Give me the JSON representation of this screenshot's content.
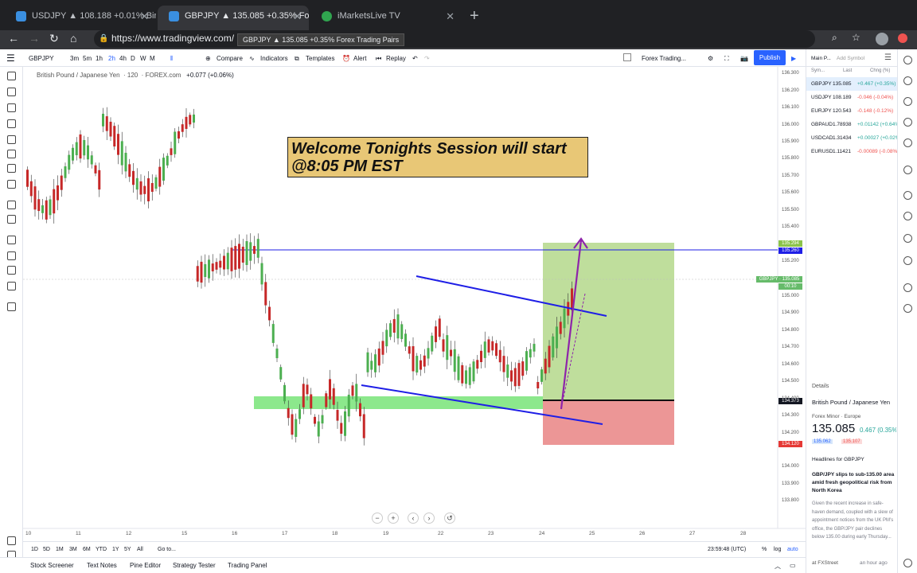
{
  "browser": {
    "tabs": [
      {
        "title": "USDJPY ▲ 108.188 +0.01% Bin"
      },
      {
        "title": "GBPJPY ▲ 135.085 +0.35% Fo"
      },
      {
        "title": "iMarketsLive TV"
      }
    ],
    "url": "https://www.tradingview.com/",
    "tooltip": "GBPJPY ▲ 135.085 +0.35% Forex Trading Pairs"
  },
  "toolbar": {
    "symbol": "GBPJPY",
    "intervals": [
      "3m",
      "5m",
      "1h",
      "2h",
      "4h",
      "D",
      "W",
      "M"
    ],
    "compare": "Compare",
    "indicators": "Indicators",
    "templates": "Templates",
    "alert": "Alert",
    "replay": "Replay",
    "layout": "Forex Trading...",
    "publish": "Publish"
  },
  "chart": {
    "symbol_title": "British Pound / Japanese Yen",
    "interval": "120",
    "exchange": "FOREX.com",
    "change": "+0.077 (+0.06%)",
    "banner_line1": "Welcome Tonights Session will start",
    "banner_line2": "@8:05 PM EST",
    "price_labels": {
      "p1": "135.294",
      "p2": "135.260",
      "p3": "GBPJPY · 135.085",
      "p3b": "00:10",
      "p4": "134.373",
      "p5": "134.120"
    },
    "time_ticks": [
      "10",
      "11",
      "12",
      "15",
      "16",
      "17",
      "18",
      "19",
      "22",
      "23",
      "24",
      "25",
      "26",
      "27",
      "28"
    ],
    "price_ticks": [
      "136.300",
      "136.200",
      "136.100",
      "136.000",
      "135.900",
      "135.800",
      "135.700",
      "135.600",
      "135.500",
      "135.400",
      "135.200",
      "135.000",
      "134.900",
      "134.800",
      "134.700",
      "134.600",
      "134.500",
      "134.400",
      "134.300",
      "134.200",
      "134.000",
      "133.900",
      "133.800"
    ]
  },
  "bottom": {
    "ranges": [
      "1D",
      "5D",
      "1M",
      "3M",
      "6M",
      "YTD",
      "1Y",
      "5Y",
      "All"
    ],
    "goto": "Go to...",
    "clock": "23:59:48 (UTC)",
    "pct": "%",
    "log": "log",
    "auto": "auto"
  },
  "panels": [
    "Stock Screener",
    "Text Notes",
    "Pine Editor",
    "Strategy Tester",
    "Trading Panel"
  ],
  "watchlist": {
    "title": "Main P...",
    "add": "Add Symbol",
    "cols": [
      "Sym...",
      "Last",
      "Chng (%)"
    ],
    "rows": [
      {
        "sym": "GBPJPY",
        "last": "135.085",
        "chg": "+0.467 (+0.35%)",
        "dir": "up"
      },
      {
        "sym": "USDJPY",
        "last": "108.189",
        "chg": "-0.046 (-0.04%)",
        "dir": "dn"
      },
      {
        "sym": "EURJPY",
        "last": "120.543",
        "chg": "-0.148 (-0.12%)",
        "dir": "dn"
      },
      {
        "sym": "GBPAUD",
        "last": "1.78938",
        "chg": "+0.01142 (+0.64%)",
        "dir": "up"
      },
      {
        "sym": "USDCAD",
        "last": "1.31434",
        "chg": "+0.00027 (+0.02%)",
        "dir": "up"
      },
      {
        "sym": "EURUSD",
        "last": "1.11421",
        "chg": "-0.00089 (-0.08%)",
        "dir": "dn"
      }
    ]
  },
  "details": {
    "label": "Details",
    "name": "British Pound / Japanese Yen",
    "category": "Forex Minor · Europe",
    "price": "135.085",
    "change": "0.467 (0.35%)",
    "bid": "135.062",
    "ask": "135.107"
  },
  "headlines": {
    "label": "Headlines for GBPJPY",
    "title": "GBP/JPY slips to sub-135.00 area amid fresh geopolitical risk from North Korea",
    "body": "Given the recent increase in safe-haven demand, coupled with a slew of appointment notices from the UK PM's office, the GBP/JPY pair declines below 135.00 during early Thursday...",
    "source": "at FXStreet",
    "time": "an hour ago"
  },
  "colors": {
    "up": "#26a69a",
    "down": "#ef5350",
    "accent": "#2962ff",
    "candle_up": "#4caf50",
    "candle_down": "#c62828",
    "trendline": "#1e1ee6"
  }
}
